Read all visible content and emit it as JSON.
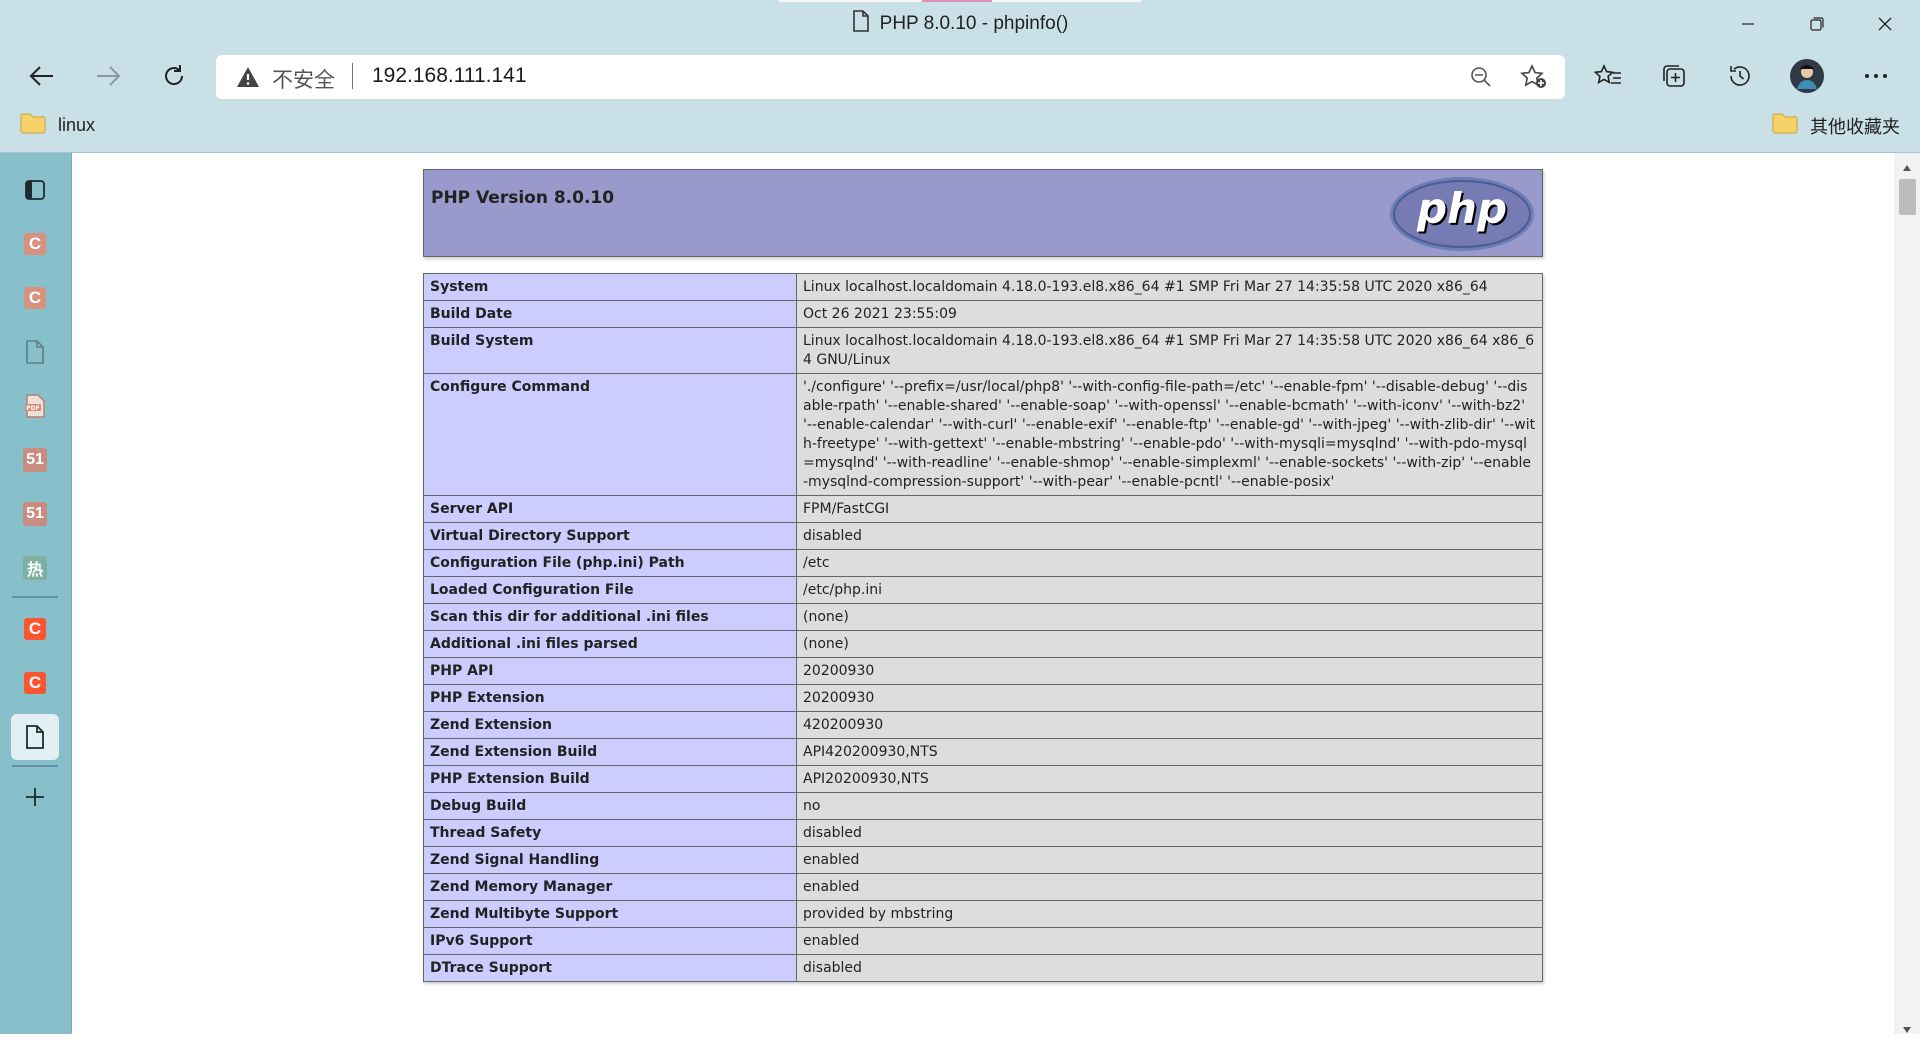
{
  "window": {
    "title": "PHP 8.0.10 - phpinfo()"
  },
  "address_bar": {
    "security_label": "不安全",
    "url": "192.168.111.141"
  },
  "bookmarks": {
    "left": [
      {
        "label": "linux",
        "icon": "folder-icon"
      }
    ],
    "right": [
      {
        "label": "其他收藏夹",
        "icon": "folder-icon"
      }
    ]
  },
  "sidebar": {
    "tabs": [
      {
        "icon": "tab-actions-icon"
      },
      {
        "icon": "csdn-favicon",
        "letter": "C",
        "color": "#d9917f"
      },
      {
        "icon": "csdn-favicon",
        "letter": "C",
        "color": "#d9917f"
      },
      {
        "icon": "page-icon"
      },
      {
        "icon": "pdf-icon"
      },
      {
        "icon": "51cto-favicon",
        "text": "51"
      },
      {
        "icon": "51cto-favicon",
        "text": "51"
      },
      {
        "icon": "re-favicon",
        "text": "热"
      },
      {
        "icon": "csdn-favicon",
        "letter": "C",
        "color": "#fc5531"
      },
      {
        "icon": "csdn-favicon",
        "letter": "C",
        "color": "#fc5531"
      },
      {
        "icon": "page-icon",
        "active": true
      },
      {
        "icon": "new-tab-icon"
      }
    ]
  },
  "phpinfo": {
    "version_title": "PHP Version 8.0.10",
    "logo_text": "php",
    "rows": [
      {
        "label": "System",
        "value": "Linux localhost.localdomain 4.18.0-193.el8.x86_64 #1 SMP Fri Mar 27 14:35:58 UTC 2020 x86_64"
      },
      {
        "label": "Build Date",
        "value": "Oct 26 2021 23:55:09"
      },
      {
        "label": "Build System",
        "value": "Linux localhost.localdomain 4.18.0-193.el8.x86_64 #1 SMP Fri Mar 27 14:35:58 UTC 2020 x86_64 x86_64 GNU/Linux"
      },
      {
        "label": "Configure Command",
        "value": "'./configure' '--prefix=/usr/local/php8' '--with-config-file-path=/etc' '--enable-fpm' '--disable-debug' '--disable-rpath' '--enable-shared' '--enable-soap' '--with-openssl' '--enable-bcmath' '--with-iconv' '--with-bz2' '--enable-calendar' '--with-curl' '--enable-exif' '--enable-ftp' '--enable-gd' '--with-jpeg' '--with-zlib-dir' '--with-freetype' '--with-gettext' '--enable-mbstring' '--enable-pdo' '--with-mysqli=mysqlnd' '--with-pdo-mysql=mysqlnd' '--with-readline' '--enable-shmop' '--enable-simplexml' '--enable-sockets' '--with-zip' '--enable-mysqlnd-compression-support' '--with-pear' '--enable-pcntl' '--enable-posix'"
      },
      {
        "label": "Server API",
        "value": "FPM/FastCGI"
      },
      {
        "label": "Virtual Directory Support",
        "value": "disabled"
      },
      {
        "label": "Configuration File (php.ini) Path",
        "value": "/etc"
      },
      {
        "label": "Loaded Configuration File",
        "value": "/etc/php.ini"
      },
      {
        "label": "Scan this dir for additional .ini files",
        "value": "(none)"
      },
      {
        "label": "Additional .ini files parsed",
        "value": "(none)"
      },
      {
        "label": "PHP API",
        "value": "20200930"
      },
      {
        "label": "PHP Extension",
        "value": "20200930"
      },
      {
        "label": "Zend Extension",
        "value": "420200930"
      },
      {
        "label": "Zend Extension Build",
        "value": "API420200930,NTS"
      },
      {
        "label": "PHP Extension Build",
        "value": "API20200930,NTS"
      },
      {
        "label": "Debug Build",
        "value": "no"
      },
      {
        "label": "Thread Safety",
        "value": "disabled"
      },
      {
        "label": "Zend Signal Handling",
        "value": "enabled"
      },
      {
        "label": "Zend Memory Manager",
        "value": "enabled"
      },
      {
        "label": "Zend Multibyte Support",
        "value": "provided by mbstring"
      },
      {
        "label": "IPv6 Support",
        "value": "enabled"
      },
      {
        "label": "DTrace Support",
        "value": "disabled"
      }
    ]
  }
}
